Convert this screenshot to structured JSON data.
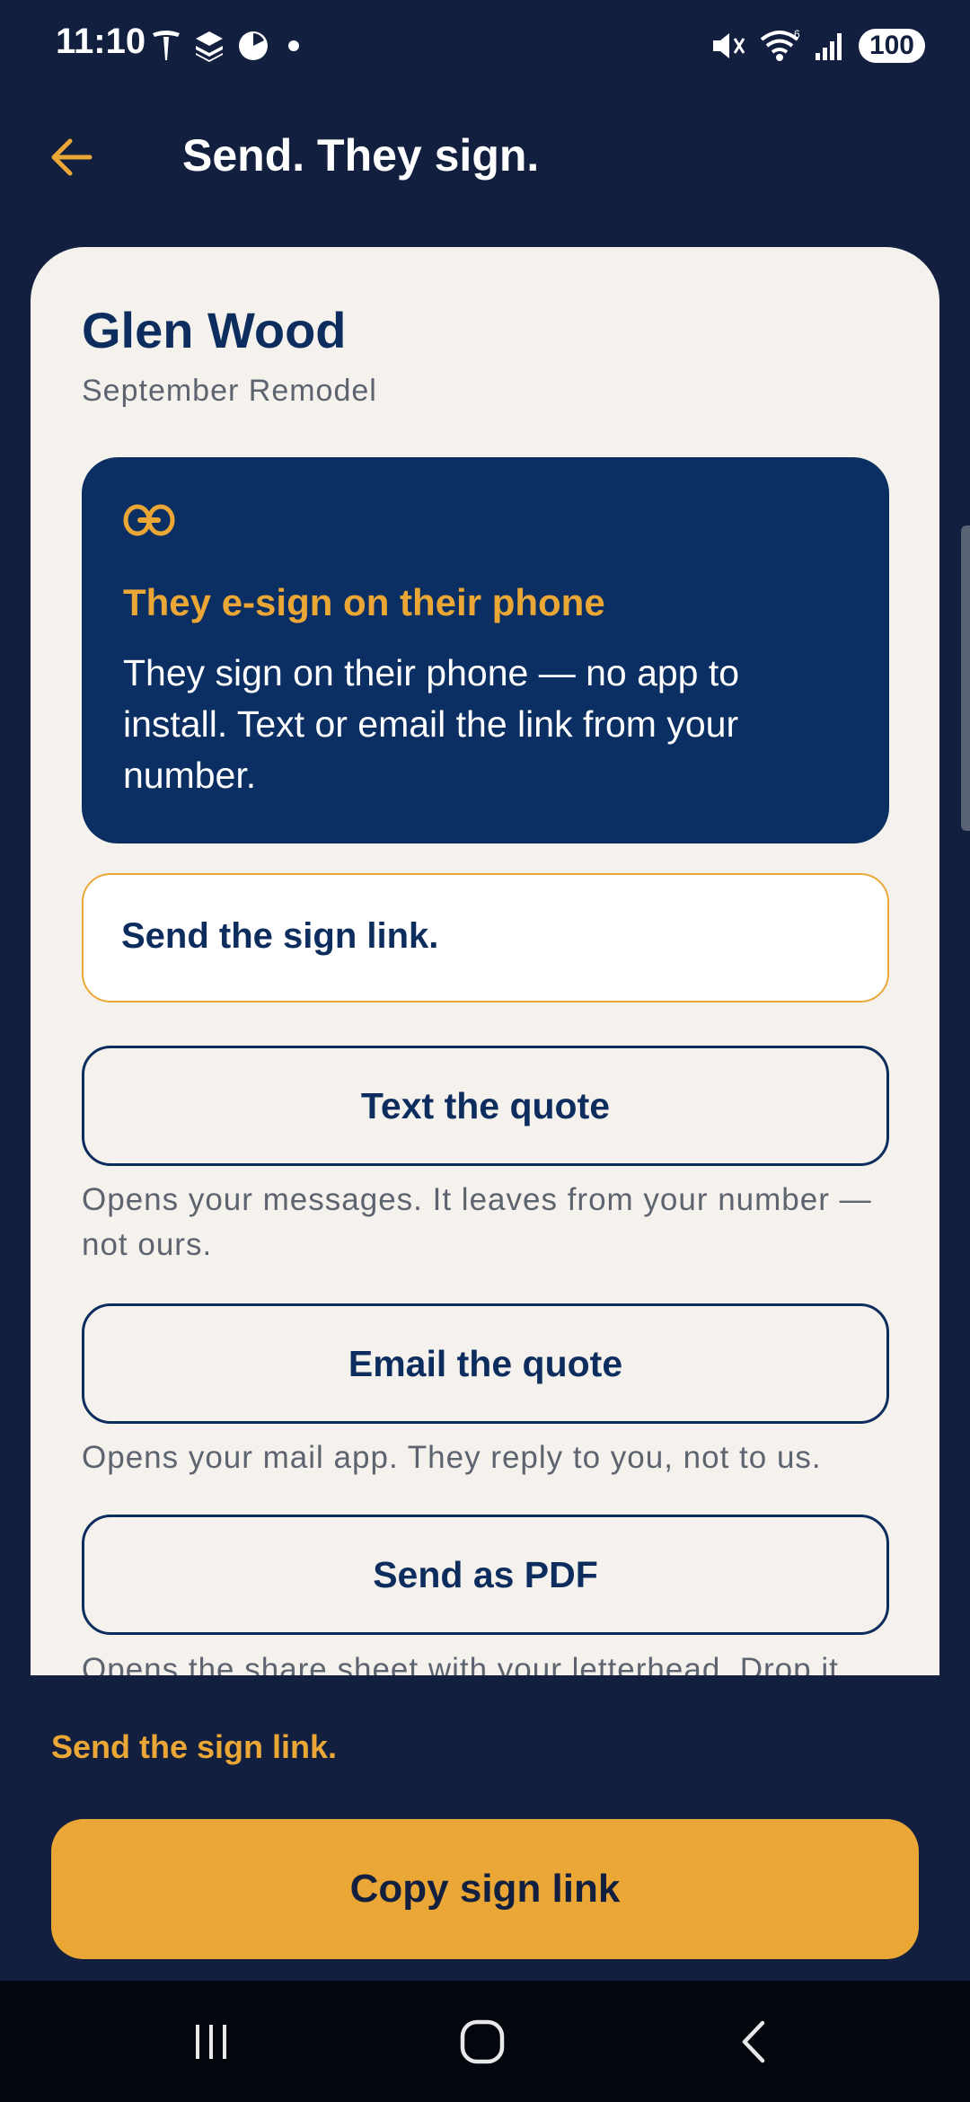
{
  "status_bar": {
    "time": "11:10",
    "battery": "100",
    "icons_left": [
      "tesla-icon",
      "layers-icon",
      "pie-icon",
      "dot-icon"
    ],
    "icons_right": [
      "mute-icon",
      "wifi-icon",
      "signal-icon",
      "battery-icon"
    ]
  },
  "header": {
    "title": "Send. They sign.",
    "back_icon": "arrow-left-icon"
  },
  "client": {
    "name": "Glen Wood",
    "project": "September Remodel"
  },
  "info": {
    "icon": "link-icon",
    "title": "They e-sign on their phone",
    "body": "They sign on their phone — no app to install. Text or email the link from your number."
  },
  "selected_option": {
    "label": "Send the sign link."
  },
  "options": [
    {
      "label": "Text the quote",
      "helper": "Opens your messages. It leaves from your number — not ours."
    },
    {
      "label": "Email the quote",
      "helper": "Opens your mail app. They reply to you, not to us."
    },
    {
      "label": "Send as PDF",
      "helper": "Opens the share sheet with your letterhead. Drop it"
    }
  ],
  "footer": {
    "hint": "Send the sign link.",
    "primary_label": "Copy sign link"
  },
  "colors": {
    "background": "#121f3f",
    "card": "#f5f2ed",
    "navy": "#0d2d5e",
    "accent": "#eba736"
  },
  "nav": {
    "recents_icon": "recents-icon",
    "home_icon": "home-icon",
    "back_icon": "back-chevron-icon"
  }
}
